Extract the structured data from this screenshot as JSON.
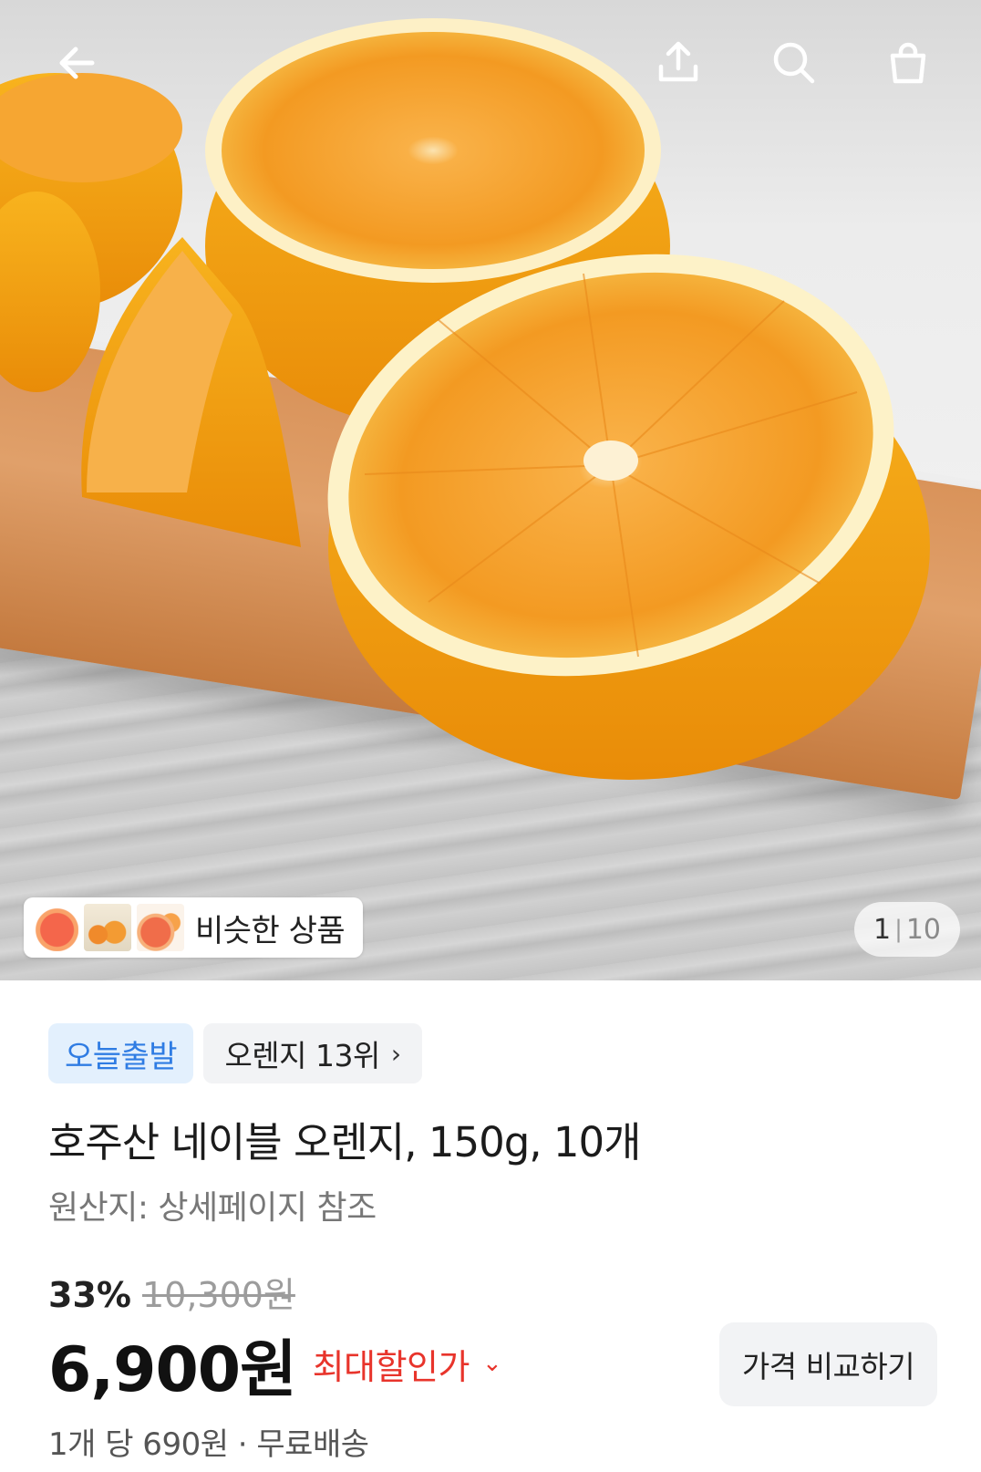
{
  "header": {
    "back_icon": "arrow-left-icon",
    "share_icon": "share-upload-icon",
    "search_icon": "search-icon",
    "cart_icon": "shopping-bag-icon"
  },
  "gallery": {
    "similar_label": "비슷한 상품",
    "page_current": "1",
    "page_separator": "|",
    "page_total": "10"
  },
  "product": {
    "badge_delivery": "오늘출발",
    "badge_rank": "오렌지 13위",
    "badge_rank_chevron": "›",
    "title": "호주산 네이블 오렌지, 150g, 10개",
    "origin": "원산지: 상세페이지 참조",
    "discount_rate": "33%",
    "original_price": "10,300원",
    "price": "6,900원",
    "max_discount_label": "최대할인가",
    "max_discount_chevron": "⌄",
    "compare_label": "가격 비교하기",
    "unit_info": "1개 당 690원 · 무료배송"
  },
  "colors": {
    "delivery_badge_bg": "#e3f0fd",
    "delivery_badge_text": "#2f7ce3",
    "max_discount_text": "#e8342b"
  }
}
